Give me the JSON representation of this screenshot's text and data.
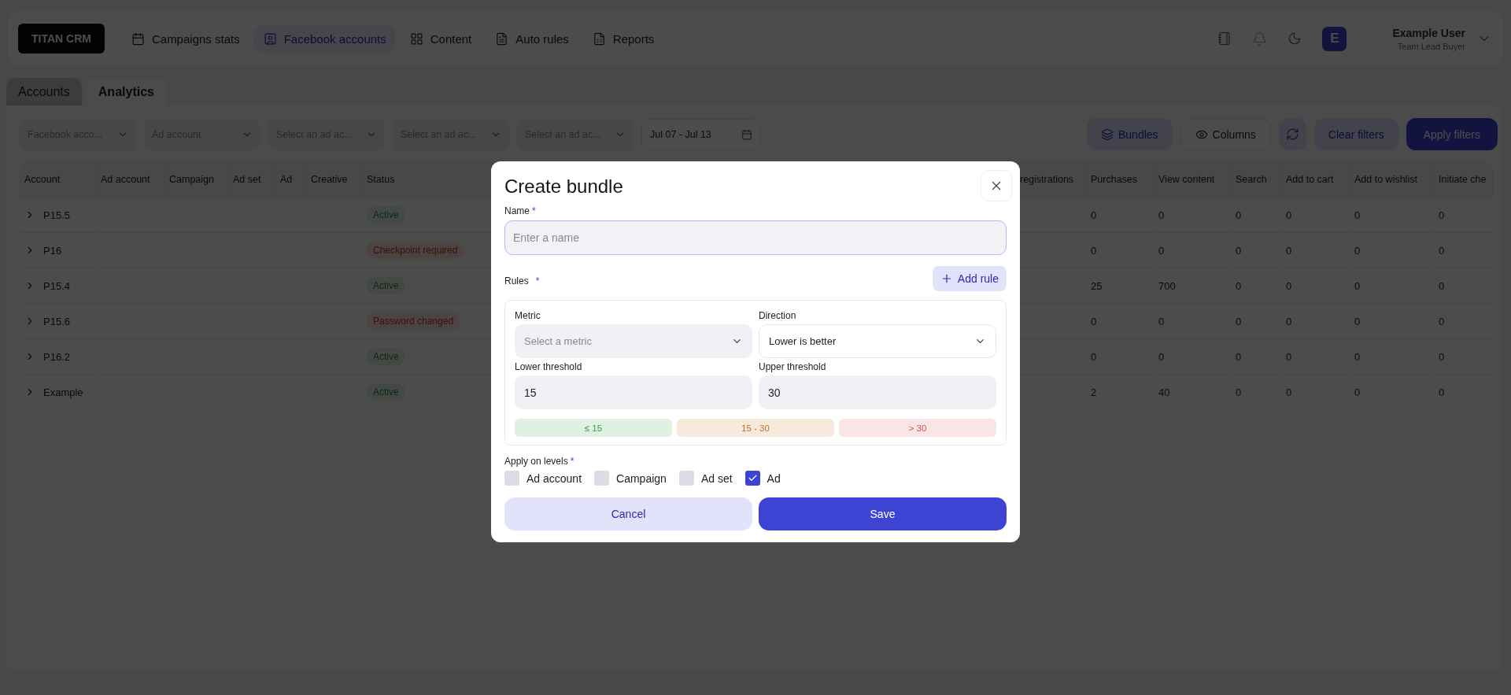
{
  "nav": {
    "logo": "TITAN CRM",
    "items": [
      {
        "label": "Campaigns stats",
        "selected": false
      },
      {
        "label": "Facebook accounts",
        "selected": true
      },
      {
        "label": "Content",
        "selected": false
      },
      {
        "label": "Auto rules",
        "selected": false
      },
      {
        "label": "Reports",
        "selected": false
      }
    ],
    "user": {
      "initial": "E",
      "name": "Example User",
      "role": "Team Lead Buyer"
    }
  },
  "tabs": [
    {
      "label": "Accounts",
      "selected": false
    },
    {
      "label": "Analytics",
      "selected": true
    }
  ],
  "filters": {
    "selects": [
      {
        "placeholder": "Facebook acco..."
      },
      {
        "placeholder": "Ad account"
      },
      {
        "placeholder": "Select an ad ac..."
      },
      {
        "placeholder": "Select an ad ac..."
      },
      {
        "placeholder": "Select an ad ac..."
      }
    ],
    "date": "Jul 07 - Jul 13",
    "buttons": [
      {
        "label": "Bundles",
        "kind": "bundles"
      },
      {
        "label": "Columns",
        "kind": "columns"
      },
      {
        "kind": "refresh"
      },
      {
        "label": "Clear filters",
        "kind": "clear"
      },
      {
        "label": "Apply filters",
        "kind": "apply"
      }
    ]
  },
  "table": {
    "columns": [
      "Account",
      "Ad account",
      "Campaign",
      "Ad set",
      "Ad",
      "Creative",
      "Status",
      "registrations",
      "Purchases",
      "View content",
      "Search",
      "Add to cart",
      "Add to wishlist",
      "Initiate che"
    ],
    "rows": [
      {
        "account": "P15.5",
        "expanded": false,
        "status": {
          "label": "Active",
          "kind": "ok"
        },
        "values": [
          "0",
          "0",
          "0",
          "0",
          "0",
          "0"
        ]
      },
      {
        "account": "P16",
        "expanded": false,
        "status": {
          "label": "Checkpoint required",
          "kind": "error"
        },
        "values": [
          "0",
          "0",
          "0",
          "0",
          "0",
          "0"
        ]
      },
      {
        "account": "P15.4",
        "expanded": false,
        "status": {
          "label": "Active",
          "kind": "ok"
        },
        "values": [
          "25",
          "700",
          "0",
          "0",
          "0",
          "0"
        ]
      },
      {
        "account": "P15.6",
        "expanded": false,
        "status": {
          "label": "Password changed",
          "kind": "error"
        },
        "values": [
          "0",
          "0",
          "0",
          "0",
          "0",
          "0"
        ]
      },
      {
        "account": "P16.2",
        "expanded": false,
        "status": {
          "label": "Active",
          "kind": "ok"
        },
        "values": [
          "0",
          "0",
          "0",
          "0",
          "0",
          "0"
        ]
      },
      {
        "account": "Example",
        "expanded": false,
        "status": {
          "label": "Active",
          "kind": "ok"
        },
        "values": [
          "2",
          "40",
          "0",
          "0",
          "0",
          "0"
        ]
      }
    ]
  },
  "modal": {
    "title": "Create bundle",
    "name": {
      "label": "Name",
      "required_mark": "*",
      "placeholder": "Enter a name"
    },
    "rules": {
      "label": "Rules",
      "required_mark": "*",
      "add_button": "Add rule"
    },
    "rule": {
      "metric": {
        "label": "Metric",
        "placeholder": "Select a metric"
      },
      "direction": {
        "label": "Direction",
        "value": "Lower is better"
      },
      "lower": {
        "label": "Lower threshold",
        "value": "15"
      },
      "upper": {
        "label": "Upper threshold",
        "value": "30"
      },
      "ranges": [
        {
          "label": "≤ 15",
          "color": "#2f9e44"
        },
        {
          "label": "15 - 30",
          "color": "#c2701a"
        },
        {
          "label": "> 30",
          "color": "#d9534f"
        }
      ]
    },
    "levels": {
      "label": "Apply on levels",
      "required_mark": "*",
      "items": [
        {
          "label": "Ad account",
          "checked": false
        },
        {
          "label": "Campaign",
          "checked": false
        },
        {
          "label": "Ad set",
          "checked": false
        },
        {
          "label": "Ad",
          "checked": true
        }
      ]
    },
    "buttons": {
      "cancel": "Cancel",
      "save": "Save"
    }
  }
}
